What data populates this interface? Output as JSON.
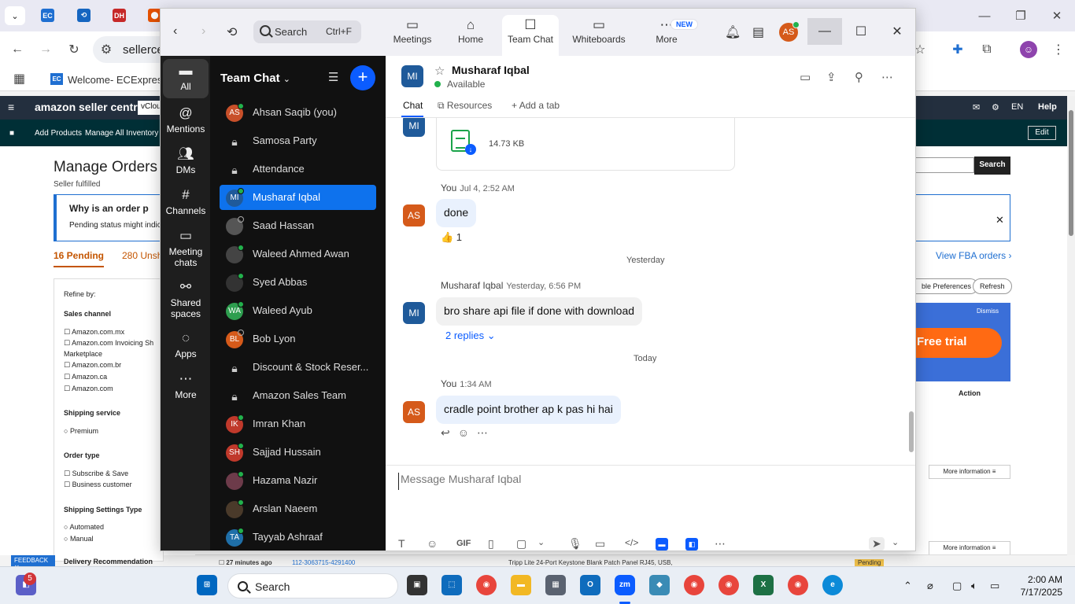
{
  "browser": {
    "url_text": "sellerce",
    "bookmark": "Welcome- ECExpres",
    "bookmark_favicon": "EC",
    "tab_favicons": [
      "EC",
      "DH"
    ]
  },
  "amazon": {
    "logo": "amazon seller central",
    "vc": "vClou",
    "lang": "EN",
    "help": "Help",
    "nav": [
      "Add Products",
      "Manage All Inventory"
    ],
    "edit": "Edit",
    "title": "Manage Orders",
    "seller_fulfilled": "Seller fulfilled",
    "info_title": "Why is an order p",
    "info_text": "Pending status might indica",
    "tab_pending": "16 Pending",
    "tab_unshipped": "280 Unsh",
    "refine": {
      "title": "Refine by:",
      "sales_channel": "Sales channel",
      "channels": [
        "Amazon.com.mx",
        "Amazon.com Invoicing Sh",
        "Marketplace",
        "Amazon.com.br",
        "Amazon.ca",
        "Amazon.com"
      ],
      "shipping_service": "Shipping service",
      "premium": "Premium",
      "order_type": "Order type",
      "order_types": [
        "Subscribe & Save",
        "Business customer"
      ],
      "shipping_settings": "Shipping Settings Type",
      "settings_types": [
        "Automated",
        "Manual"
      ],
      "delivery_rec": "Delivery Recommendation"
    },
    "search_btn": "Search",
    "view_fba": "View FBA orders ›",
    "pref_btn": "ble Preferences",
    "refresh_btn": "Refresh",
    "dismiss": "Dismiss",
    "free_trial": "Free trial",
    "action": "Action",
    "more_info": "More information",
    "row_time": "27 minutes ago",
    "row_order": "112-3063715-4291400",
    "row_product": "Tripp Lite 24-Port Keystone Blank Patch Panel RJ45, USB,",
    "row_status": "Pending",
    "feedback": "FEEDBACK"
  },
  "zoom": {
    "search_label": "Search",
    "search_shortcut": "Ctrl+F",
    "tabs": [
      {
        "label": "Meetings"
      },
      {
        "label": "Home"
      },
      {
        "label": "Team Chat"
      },
      {
        "label": "Whiteboards"
      },
      {
        "label": "More",
        "badge": "NEW"
      }
    ],
    "user_initials": "AS",
    "rail": [
      {
        "label": "All"
      },
      {
        "label": "Mentions"
      },
      {
        "label": "DMs"
      },
      {
        "label": "Channels"
      },
      {
        "label": "Meeting chats"
      },
      {
        "label": "Shared spaces"
      },
      {
        "label": "Apps"
      },
      {
        "label": "More"
      }
    ],
    "list_title": "Team Chat",
    "chats": [
      {
        "initials": "AS",
        "name": "Ahsan Saqib (you)",
        "color": "#c8502a",
        "status": "online"
      },
      {
        "initials": "",
        "name": "Samosa Party",
        "type": "lock"
      },
      {
        "initials": "",
        "name": "Attendance",
        "type": "lock"
      },
      {
        "initials": "MI",
        "name": "Musharaf Iqbal",
        "color": "#1f5a9a",
        "status": "online",
        "active": true
      },
      {
        "initials": "",
        "name": "Saad Hassan",
        "color": "#555",
        "status": "away"
      },
      {
        "initials": "",
        "name": "Waleed Ahmed Awan",
        "color": "#444",
        "status": "online"
      },
      {
        "initials": "",
        "name": "Syed Abbas",
        "color": "#333",
        "status": "online"
      },
      {
        "initials": "WA",
        "name": "Waleed Ayub",
        "color": "#2e9e4f",
        "status": "online"
      },
      {
        "initials": "BL",
        "name": "Bob Lyon",
        "color": "#d55a1a",
        "status": "away"
      },
      {
        "initials": "",
        "name": "Discount & Stock Reser...",
        "type": "lock"
      },
      {
        "initials": "",
        "name": "Amazon Sales Team",
        "type": "lock"
      },
      {
        "initials": "IK",
        "name": "Imran Khan",
        "color": "#c0392b",
        "status": "online"
      },
      {
        "initials": "SH",
        "name": "Sajjad Hussain",
        "color": "#c0392b",
        "status": "online"
      },
      {
        "initials": "",
        "name": "Hazama Nazir",
        "color": "#6d3b4a",
        "status": "online"
      },
      {
        "initials": "",
        "name": "Arslan Naeem",
        "color": "#4a3a2a",
        "status": "online"
      },
      {
        "initials": "TA",
        "name": "Tayyab Ashraaf",
        "color": "#1f6fa8",
        "status": "online"
      }
    ],
    "contact": {
      "initials": "MI",
      "name": "Musharaf Iqbal",
      "status": "Available"
    },
    "chat_tabs": [
      "Chat",
      "Resources",
      "Add a tab"
    ],
    "file_size": "14.73 KB",
    "messages": [
      {
        "sender": "You",
        "time": "Jul 4, 2:52 AM",
        "text": "done",
        "reaction": "👍 1",
        "initials": "AS"
      },
      {
        "date": "Yesterday"
      },
      {
        "sender": "Musharaf Iqbal",
        "time": "Yesterday, 6:56 PM",
        "text": "bro share api file if done with download",
        "replies": "2 replies",
        "initials": "MI"
      },
      {
        "date": "Today"
      },
      {
        "sender": "You",
        "time": "1:34 AM",
        "text": "cradle point brother ap k pas hi hai",
        "initials": "AS"
      }
    ],
    "composer_placeholder": "Message Musharaf Iqbal",
    "tool_gif": "GIF"
  },
  "taskbar": {
    "search_label": "Search",
    "notification_count": "5",
    "time": "2:00 AM",
    "date": "7/17/2025"
  }
}
